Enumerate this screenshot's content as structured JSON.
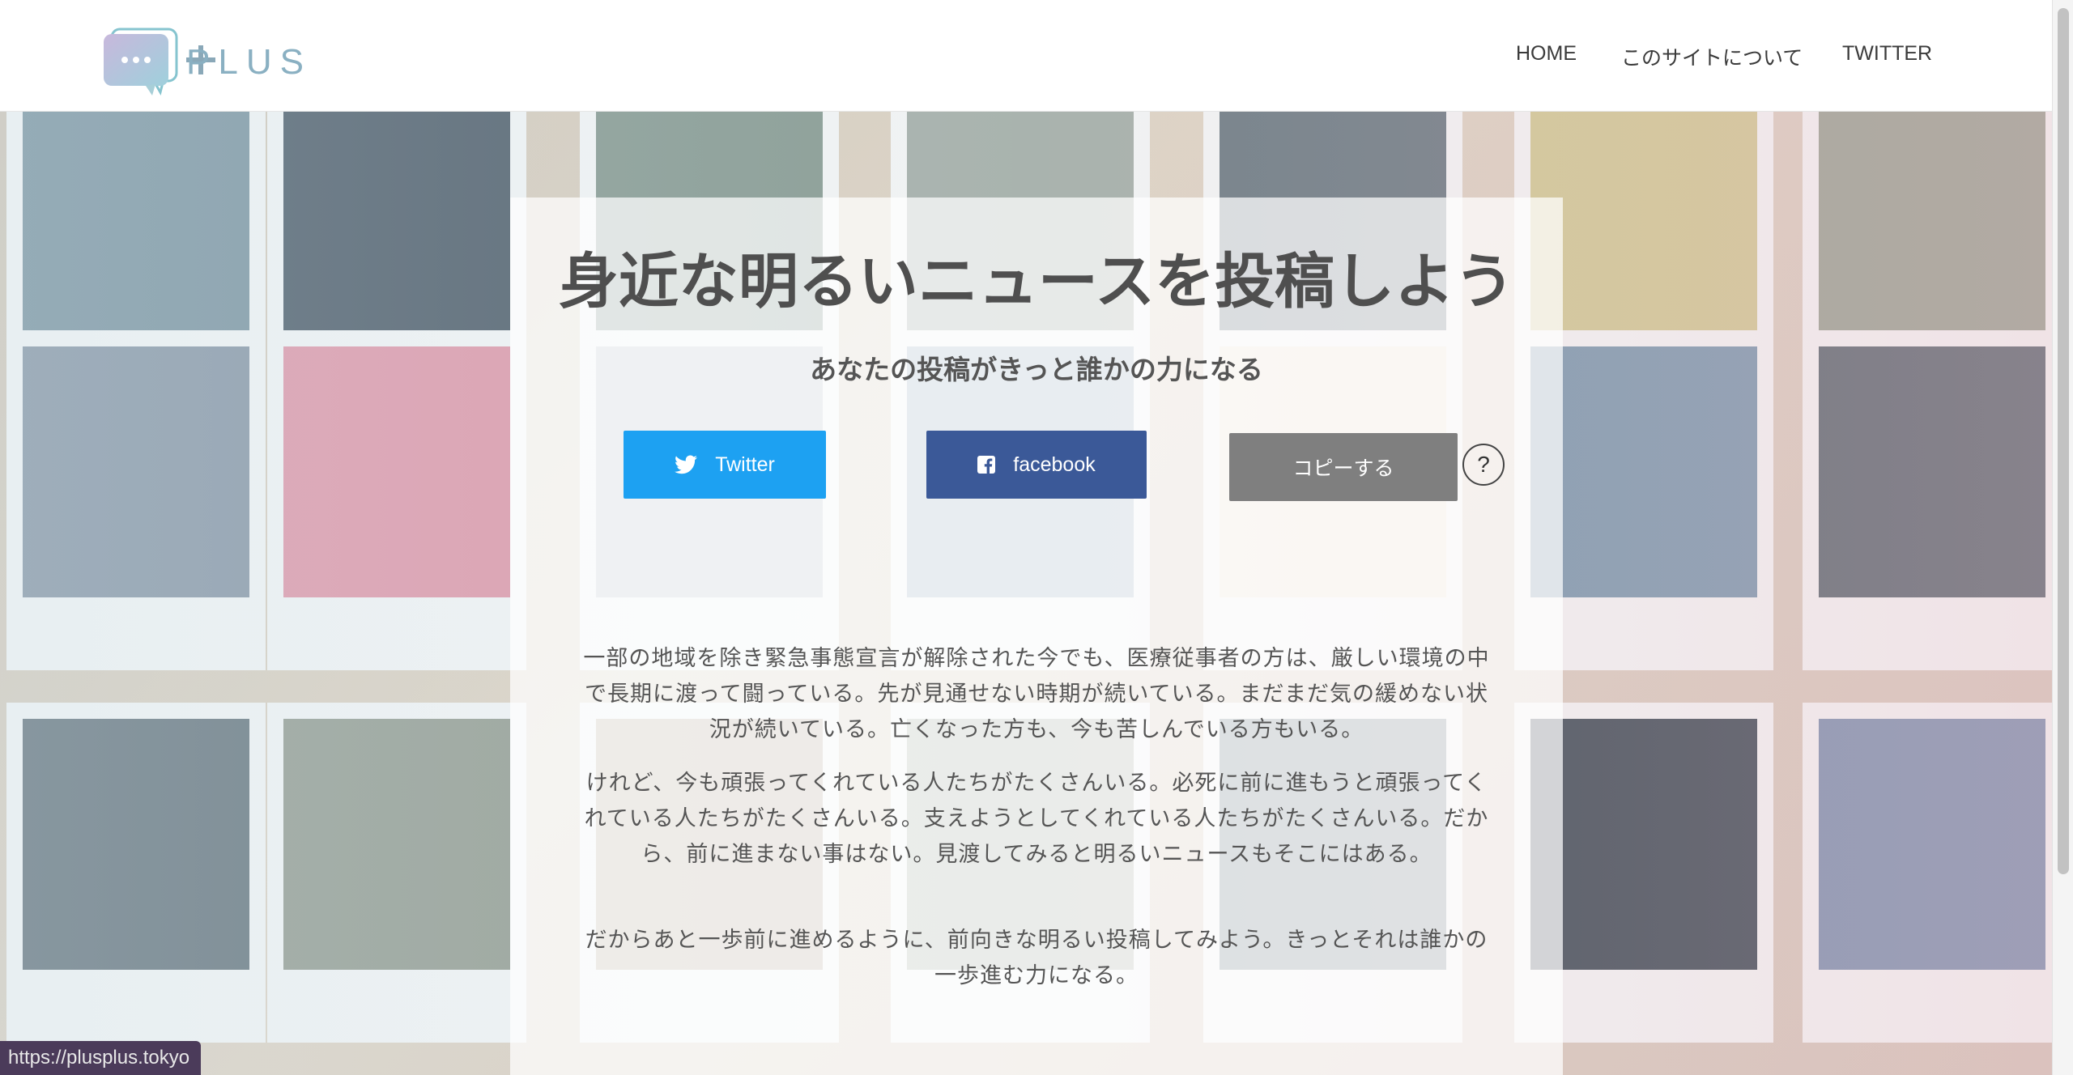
{
  "header": {
    "logo_text": "+PLUS",
    "logo_word": "PLUS",
    "nav": [
      {
        "label": "HOME"
      },
      {
        "label": "このサイトについて"
      },
      {
        "label": "TWITTER"
      }
    ]
  },
  "hero": {
    "title": "身近な明るいニュースを投稿しよう",
    "subtitle": "あなたの投稿がきっと誰かの力になる"
  },
  "share": {
    "twitter_label": "Twitter",
    "facebook_label": "facebook",
    "copy_label": "コピーする",
    "help_label": "?",
    "colors": {
      "twitter": "#1da1f2",
      "facebook": "#3b5998",
      "copy": "#7f7f7f"
    }
  },
  "body": {
    "paragraph1": "一部の地域を除き緊急事態宣言が解除された今でも、医療従事者の方は、厳しい環境の中で長期に渡って闘っている。先が見通せない時期が続いている。まだまだ気の緩めない状況が続いている。亡くなった方も、今も苦しんでいる方もいる。",
    "paragraph2": "けれど、今も頑張ってくれている人たちがたくさんいる。必死に前に進もうと頑張ってくれている人たちがたくさんいる。支えようとしてくれている人たちがたくさんいる。だから、前に進まない事はない。見渡してみると明るいニュースもそこにはある。",
    "paragraph3": "だからあと一歩前に進めるように、前向きな明るい投稿してみよう。きっとそれは誰かの一歩進む力になる。"
  },
  "status_bar": {
    "url": "https://plusplus.tokyo"
  },
  "icons": {
    "logo": "speech-bubble-icon",
    "twitter": "twitter-bird-icon",
    "facebook": "facebook-square-icon"
  }
}
